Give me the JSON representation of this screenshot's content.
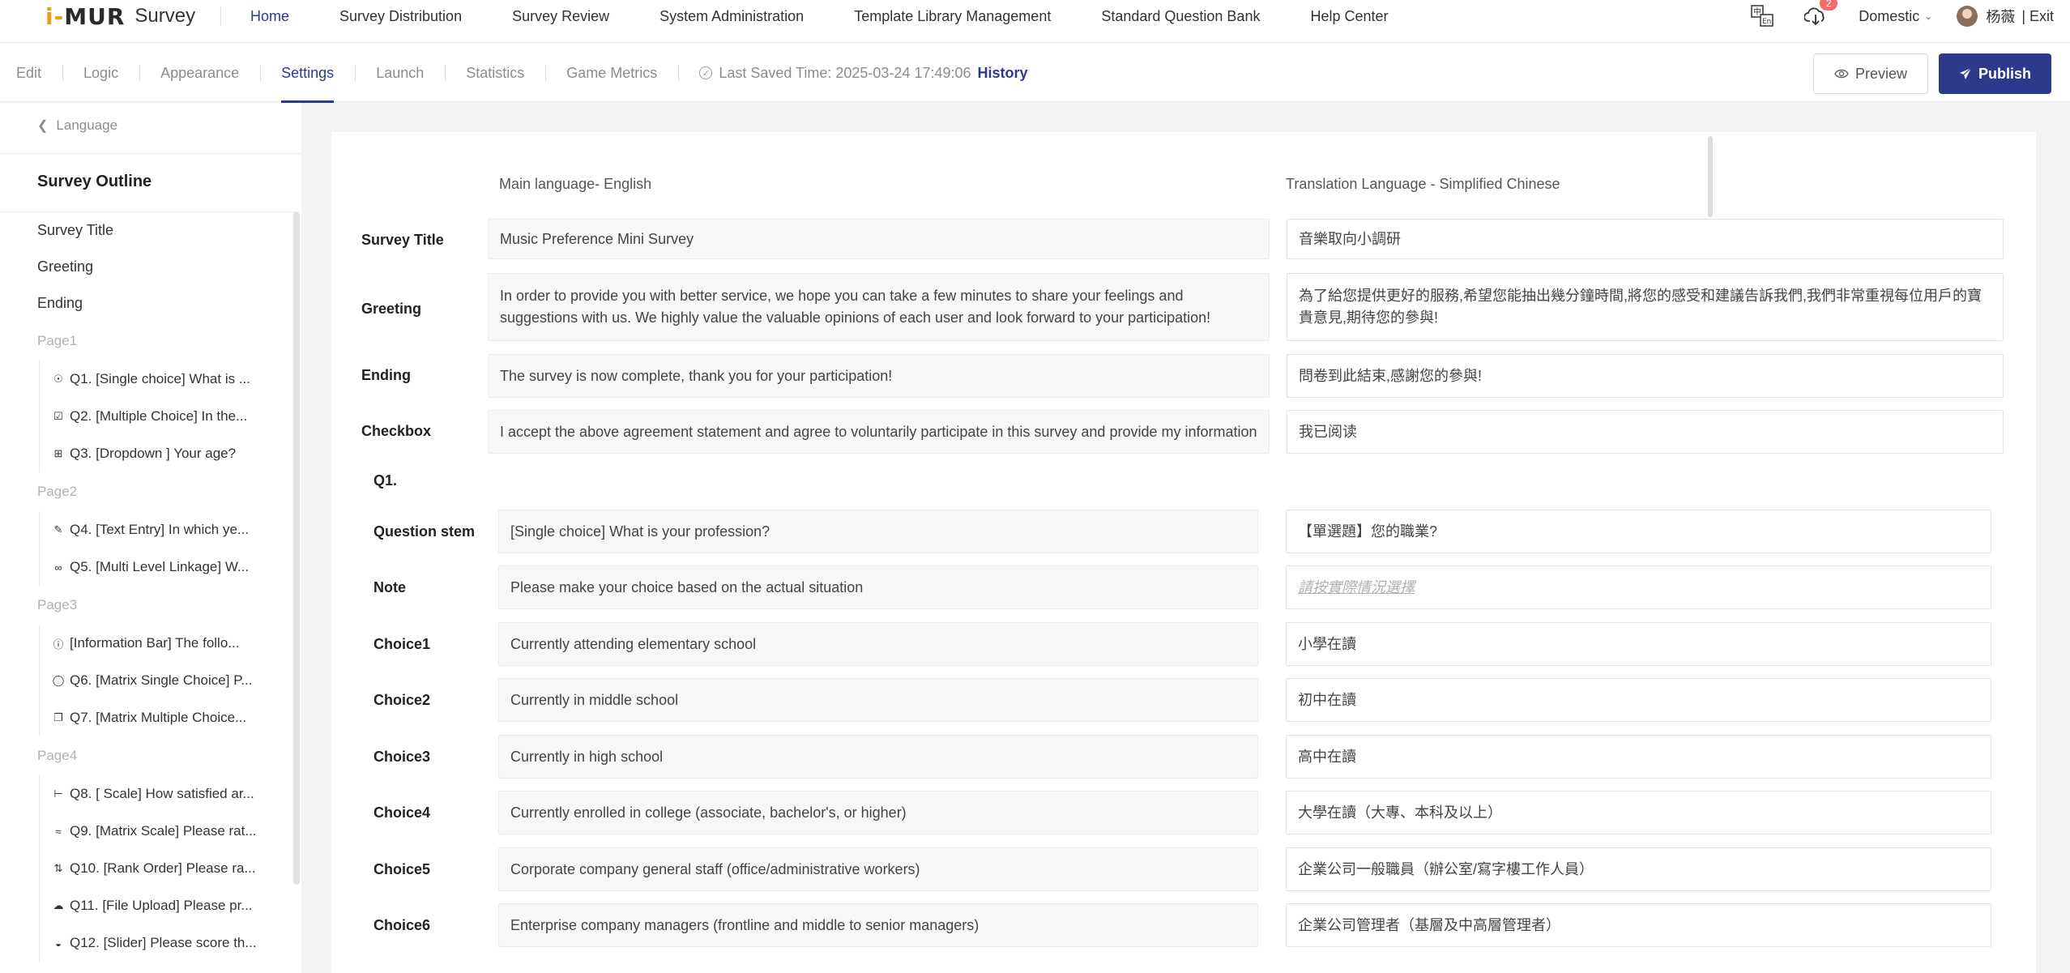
{
  "app": {
    "logo_mark_a": "i-",
    "logo_mark_b": "MUR",
    "logo_text": "Survey"
  },
  "nav": {
    "items": [
      "Home",
      "Survey Distribution",
      "Survey Review",
      "System Administration",
      "Template Library Management",
      "Standard Question Bank",
      "Help Center"
    ],
    "active": "Home"
  },
  "topright": {
    "download_badge": "2",
    "region": "Domestic",
    "user_name": "杨薇",
    "exit": "| Exit",
    "icons": [
      "translate-icon",
      "cloud-download-icon",
      "chevron-down-icon",
      "avatar"
    ]
  },
  "tabs": {
    "items": [
      "Edit",
      "Logic",
      "Appearance",
      "Settings",
      "Launch",
      "Statistics",
      "Game Metrics"
    ],
    "active": "Settings"
  },
  "saved": {
    "text": "Last Saved Time: 2025-03-24 17:49:06",
    "history": "History"
  },
  "buttons": {
    "preview": "Preview",
    "publish": "Publish"
  },
  "sidebar": {
    "back": "Language",
    "title": "Survey Outline",
    "items": [
      "Survey Title",
      "Greeting",
      "Ending"
    ],
    "pages": [
      {
        "label": "Page1",
        "questions": [
          {
            "icon": "radio-icon",
            "text": "Q1. [Single choice] What is ..."
          },
          {
            "icon": "checkbox-icon",
            "text": "Q2. [Multiple Choice] In the..."
          },
          {
            "icon": "dropdown-icon",
            "text": "Q3. [Dropdown ] Your age?"
          }
        ]
      },
      {
        "label": "Page2",
        "questions": [
          {
            "icon": "pencil-icon",
            "text": "Q4. [Text Entry] In which ye..."
          },
          {
            "icon": "link-icon",
            "text": "Q5. [Multi Level Linkage] W..."
          }
        ]
      },
      {
        "label": "Page3",
        "questions": [
          {
            "icon": "info-icon",
            "text": "[Information Bar] The follo..."
          },
          {
            "icon": "matrix-single-icon",
            "text": "Q6. [Matrix Single Choice] P..."
          },
          {
            "icon": "matrix-multiple-icon",
            "text": "Q7. [Matrix Multiple Choice..."
          }
        ]
      },
      {
        "label": "Page4",
        "questions": [
          {
            "icon": "scale-icon",
            "text": "Q8. [ Scale] How satisfied ar..."
          },
          {
            "icon": "matrix-scale-icon",
            "text": "Q9. [Matrix Scale] Please rat..."
          },
          {
            "icon": "rank-icon",
            "text": "Q10. [Rank Order] Please ra..."
          },
          {
            "icon": "upload-icon",
            "text": "Q11. [File Upload] Please pr..."
          },
          {
            "icon": "slider-icon",
            "text": "Q12. [Slider] Please score th..."
          }
        ]
      }
    ]
  },
  "main": {
    "main_language": "Main language- English",
    "translation_language": "Translation Language - Simplified Chinese",
    "rows": [
      {
        "label": "Survey Title",
        "main": "Music Preference Mini Survey",
        "translation": "音樂取向小調研"
      },
      {
        "label": "Greeting",
        "main": "In order to provide you with better service, we hope you can take a few minutes to share your feelings and suggestions with us. We highly value the valuable opinions of each user and look forward to your participation!",
        "translation": "為了給您提供更好的服務,希望您能抽出幾分鐘時間,將您的感受和建議告訴我們,我們非常重視每位用戶的寶貴意見,期待您的參與!"
      },
      {
        "label": "Ending",
        "main": "The survey is now complete, thank you for your participation!",
        "translation": "問卷到此結束,感謝您的參與!"
      },
      {
        "label": "Checkbox",
        "main": "I accept the above agreement statement and agree to voluntarily participate in this survey and provide my information",
        "translation": "我已阅读"
      }
    ],
    "q1": {
      "heading": "Q1.",
      "rows": [
        {
          "label": "Question stem",
          "main": "[Single choice] What is your profession?",
          "translation": "【單選題】您的職業?"
        },
        {
          "label": "Note",
          "main": "Please make your choice based on the actual situation",
          "translation": "請按實際情況選擇"
        },
        {
          "label": "Choice1",
          "main": "Currently attending elementary school",
          "translation": "小學在讀"
        },
        {
          "label": "Choice2",
          "main": "Currently in middle school",
          "translation": "初中在讀"
        },
        {
          "label": "Choice3",
          "main": "Currently in high school",
          "translation": "高中在讀"
        },
        {
          "label": "Choice4",
          "main": "Currently enrolled in college (associate, bachelor's, or higher)",
          "translation": "大學在讀（大專、本科及以上）"
        },
        {
          "label": "Choice5",
          "main": "Corporate company general staff (office/administrative workers)",
          "translation": "企業公司一般職員（辦公室/寫字樓工作人員）"
        },
        {
          "label": "Choice6",
          "main": "Enterprise company managers (frontline and middle to senior managers)",
          "translation": "企業公司管理者（基層及中高層管理者）"
        }
      ]
    }
  },
  "colors": {
    "primary": "#2d3a8c",
    "badge": "#f56c6c",
    "logo_accent": "#e3a316"
  }
}
